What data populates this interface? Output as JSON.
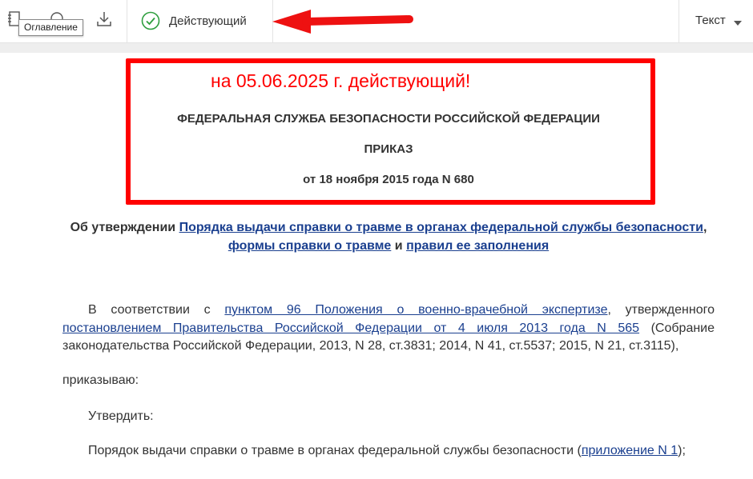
{
  "toolbar": {
    "tooltip": "Оглавление",
    "status_label": "Действующий",
    "view_mode": "Текст"
  },
  "document": {
    "annotation": "на 05.06.2025 г. действующий!",
    "agency": "ФЕДЕРАЛЬНАЯ СЛУЖБА БЕЗОПАСНОСТИ РОССИЙСКОЙ ФЕДЕРАЦИИ",
    "doc_type": "ПРИКАЗ",
    "doc_date": "от 18 ноября 2015 года N 680",
    "subject": {
      "prefix": "Об утверждении ",
      "link1": "Порядка выдачи справки о травме в органах федеральной службы безопасности",
      "sep1": ", ",
      "link2": "формы справки о травме",
      "sep2": " и ",
      "link3": "правил ее заполнения"
    },
    "p1": {
      "t1": "В соответствии с ",
      "link1": "пунктом 96 Положения о военно-врачебной экспертизе",
      "t2": ", утвержденного ",
      "link2": "постановлением Правительства Российской Федерации от 4 июля 2013 года N 565",
      "t3": " (Собрание законодательства Российской Федерации, 2013, N 28, ст.3831; 2014, N 41, ст.5537; 2015, N 21, ст.3115),"
    },
    "p2": "приказываю:",
    "p3": "Утвердить:",
    "p4": {
      "t1": "Порядок выдачи справки о травме в органах федеральной службы безопасности (",
      "link1": "приложение N 1",
      "t2": ");"
    }
  }
}
